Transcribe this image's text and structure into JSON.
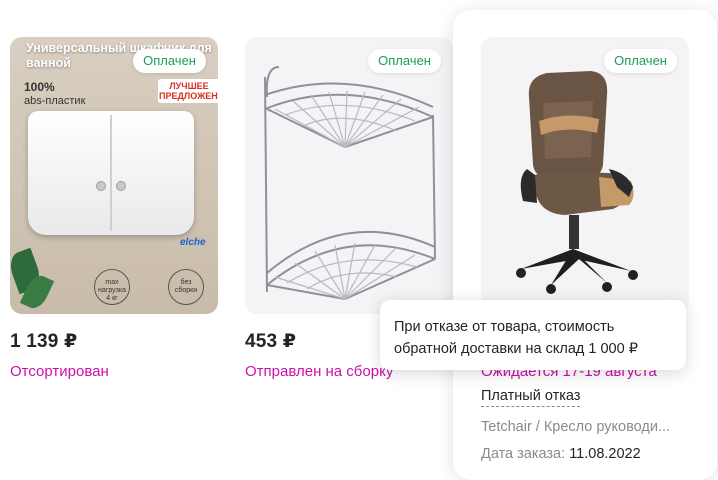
{
  "products": [
    {
      "badge": "Оплачен",
      "price": "1 139 ₽",
      "status": "Отсортирован",
      "image": {
        "title": "Универсальный шкафчик для ванной",
        "abs_percent": "100%",
        "abs_text": "abs-пластик",
        "best_offer": "ЛУЧШЕЕ ПРЕДЛОЖЕНИЕ",
        "brand": "elche",
        "max_load": "max нагрузка",
        "weight": "4 кг",
        "no_assembly": "без сборки"
      }
    },
    {
      "badge": "Оплачен",
      "price": "453 ₽",
      "status": "Отправлен на сборку"
    },
    {
      "badge": "Оплачен",
      "status": "Ожидается 17-19 августа",
      "refusal_link": "Платный отказ",
      "brand_name": "Tetchair / Кресло руководи...",
      "order_date_label": "Дата заказа:",
      "order_date_value": "11.08.2022"
    }
  ],
  "tooltip": {
    "text": "При отказе от товара, стоимость обратной доставки на склад 1 000 ₽"
  },
  "colors": {
    "badge_green": "#1c9b5c",
    "status_magenta": "#cb11ab",
    "muted_gray": "#8b8b8b"
  }
}
